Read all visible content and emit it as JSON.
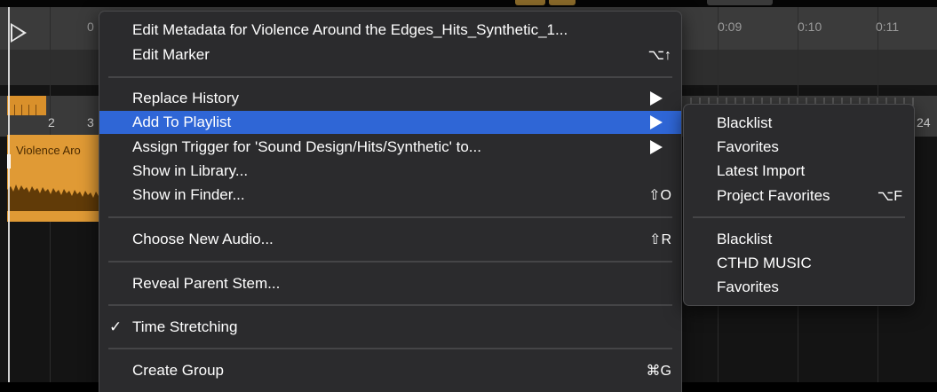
{
  "timeline": {
    "ruler_labels": [
      "0",
      "0:09",
      "0:10",
      "0:11"
    ],
    "bar_numbers": [
      "2",
      "3",
      "24"
    ],
    "clip_title": "Violence Aro"
  },
  "main_menu": {
    "items": [
      {
        "label": "Edit Metadata for Violence Around the Edges_Hits_Synthetic_1...",
        "shortcut": "",
        "submenu": false
      },
      {
        "label": "Edit Marker",
        "shortcut": "⌥↑",
        "submenu": false
      },
      {
        "label": "Replace History",
        "shortcut": "",
        "submenu": true
      },
      {
        "label": "Add To Playlist",
        "shortcut": "",
        "submenu": true
      },
      {
        "label": "Assign Trigger for 'Sound Design/Hits/Synthetic' to...",
        "shortcut": "",
        "submenu": true
      },
      {
        "label": "Show in Library...",
        "shortcut": "",
        "submenu": false
      },
      {
        "label": "Show in Finder...",
        "shortcut": "⇧O",
        "submenu": false
      },
      {
        "label": "Choose New Audio...",
        "shortcut": "⇧R",
        "submenu": false
      },
      {
        "label": "Reveal Parent Stem...",
        "shortcut": "",
        "submenu": false
      },
      {
        "label": "Time Stretching",
        "shortcut": "",
        "submenu": false,
        "check": "✓"
      },
      {
        "label": "Create Group",
        "shortcut": "⌘G",
        "submenu": false
      }
    ]
  },
  "sub_menu": {
    "items": [
      {
        "label": "Blacklist",
        "shortcut": ""
      },
      {
        "label": "Favorites",
        "shortcut": ""
      },
      {
        "label": "Latest Import",
        "shortcut": ""
      },
      {
        "label": "Project Favorites",
        "shortcut": "⌥F"
      },
      {
        "label": "Blacklist",
        "shortcut": ""
      },
      {
        "label": "CTHD MUSIC",
        "shortcut": ""
      },
      {
        "label": "Favorites",
        "shortcut": ""
      }
    ]
  },
  "colors": {
    "highlight": "#2f66d6",
    "menu_bg": "#2b2b2d",
    "clip": "#e09a35"
  }
}
